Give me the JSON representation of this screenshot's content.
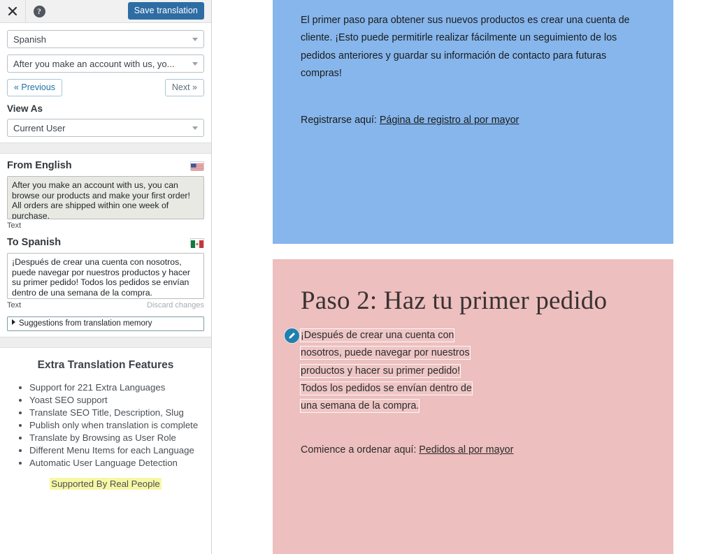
{
  "sidebar": {
    "toolbar": {
      "close_icon": "close-icon",
      "help_icon": "help-icon",
      "help_glyph": "?",
      "save_label": "Save translation",
      "save_color": "#2e6da4"
    },
    "controls": {
      "language_select": "Spanish",
      "string_select": "After you make an account with us, yo...",
      "previous_label": "« Previous",
      "next_label": "Next »",
      "view_as_label": "View As",
      "view_as_select": "Current User"
    },
    "translation": {
      "source_heading": "From English",
      "source_flag": "us-flag-icon",
      "source_text": "After you make an account with us, you can browse our products and make your first order! All orders are shipped within one week of purchase.",
      "source_field_label": "Text",
      "target_heading": "To Spanish",
      "target_flag": "mx-flag-icon",
      "target_text": "¡Después de crear una cuenta con nosotros, puede navegar por nuestros productos y hacer su primer pedido! Todos los pedidos se envían dentro de una semana de la compra.",
      "target_field_label": "Text",
      "discard_label": "Discard changes",
      "suggestions_label": "Suggestions from translation memory"
    },
    "features": {
      "title": "Extra Translation Features",
      "items": [
        "Support for 221 Extra Languages",
        "Yoast SEO support",
        "Translate SEO Title, Description, Slug",
        "Publish only when translation is complete",
        "Translate by Browsing as User Role",
        "Different Menu Items for each Language",
        "Automatic User Language Detection"
      ],
      "supported_label": "Supported By Real People",
      "highlight_color": "#f7f7a5"
    }
  },
  "content": {
    "blue_block": {
      "background": "#86b6ec",
      "paragraph": "El primer paso para obtener sus nuevos productos es crear una cuenta de cliente. ¡Esto puede permitirle realizar fácilmente un seguimiento de los pedidos anteriores y guardar su información de contacto para futuras compras!",
      "cta_prefix": "Registrarse aquí: ",
      "cta_link": "Página de registro al por mayor"
    },
    "pink_block": {
      "background": "#edbfbf",
      "heading": "Paso 2: Haz tu primer pedido",
      "edit_icon": "pencil-icon",
      "paragraph_segments": [
        "¡Después de crear una cuenta con",
        "nosotros, puede navegar por nuestros",
        "productos y hacer su primer pedido!",
        "Todos los pedidos se envían dentro de",
        "una semana de la compra."
      ],
      "cta_prefix": "Comience a ordenar aquí: ",
      "cta_link": "Pedidos al por mayor"
    }
  }
}
